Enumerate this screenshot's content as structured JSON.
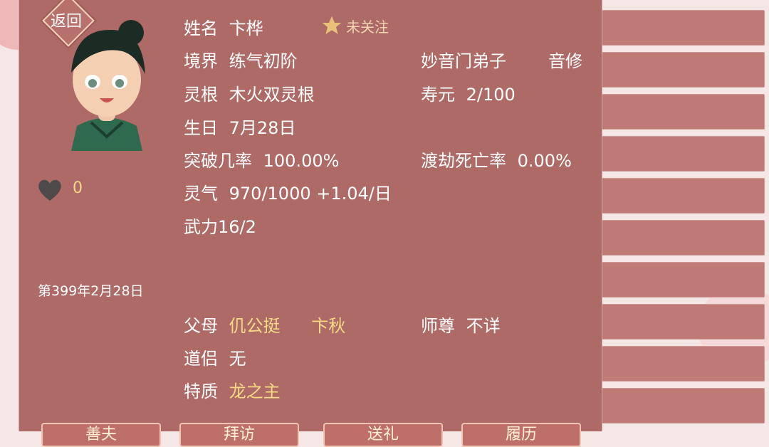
{
  "top_bar": {
    "back_label": "返回"
  },
  "profile": {
    "name_label": "姓名",
    "name_value": "卞桦",
    "follow_label": "未关注",
    "realm_label": "境界",
    "realm_value": "练气初阶",
    "sect": "妙音门弟子",
    "profession": "音修",
    "root_label": "灵根",
    "root_value": "木火双灵根",
    "lifespan_label": "寿元",
    "lifespan_value": "2/100",
    "birthday_label": "生日",
    "birthday_value": "7月28日",
    "breakthrough_label": "突破几率",
    "breakthrough_value": "100.00%",
    "tribulation_label": "渡劫死亡率",
    "tribulation_value": "0.00%",
    "qi_label": "灵气",
    "qi_value": "970/1000 +1.04/日",
    "force_label": "武力",
    "force_value": "16/2",
    "heart_count": "0",
    "date": "第399年2月28日",
    "parents_label": "父母",
    "parent1": "仉公挺",
    "parent2": "卞秋",
    "master_label": "师尊",
    "master_value": "不详",
    "partner_label": "道侣",
    "partner_value": "无",
    "trait_label": "特质",
    "trait_value": "龙之主"
  },
  "bottom_buttons": [
    "善夫",
    "拜访",
    "送礼",
    "履历"
  ],
  "colors": {
    "panel_bg": "#ad6a66",
    "gold_text": "#f7da86",
    "white_text": "#ffffff"
  }
}
